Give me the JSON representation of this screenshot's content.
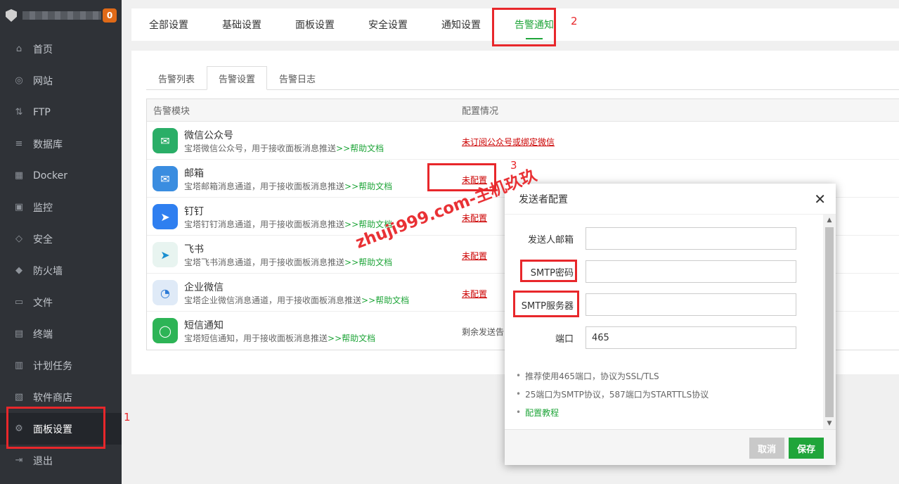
{
  "sidebar": {
    "badge": "0",
    "items": [
      {
        "label": "首页",
        "icon": "home-icon",
        "glyph": "⌂"
      },
      {
        "label": "网站",
        "icon": "globe-icon",
        "glyph": "◎"
      },
      {
        "label": "FTP",
        "icon": "ftp-icon",
        "glyph": "⇅"
      },
      {
        "label": "数据库",
        "icon": "database-icon",
        "glyph": "≡"
      },
      {
        "label": "Docker",
        "icon": "docker-icon",
        "glyph": "▦"
      },
      {
        "label": "监控",
        "icon": "monitor-icon",
        "glyph": "▣"
      },
      {
        "label": "安全",
        "icon": "shield-icon",
        "glyph": "◇"
      },
      {
        "label": "防火墙",
        "icon": "firewall-icon",
        "glyph": "◆"
      },
      {
        "label": "文件",
        "icon": "folder-icon",
        "glyph": "▭"
      },
      {
        "label": "终端",
        "icon": "terminal-icon",
        "glyph": "▤"
      },
      {
        "label": "计划任务",
        "icon": "calendar-icon",
        "glyph": "▥"
      },
      {
        "label": "软件商店",
        "icon": "store-icon",
        "glyph": "▧"
      },
      {
        "label": "面板设置",
        "icon": "gear-icon",
        "glyph": "⚙"
      },
      {
        "label": "退出",
        "icon": "logout-icon",
        "glyph": "⇥"
      }
    ]
  },
  "annotations": {
    "one": "1",
    "two": "2",
    "three": "3"
  },
  "top_tabs": [
    "全部设置",
    "基础设置",
    "面板设置",
    "安全设置",
    "通知设置",
    "告警通知"
  ],
  "sub_tabs": [
    "告警列表",
    "告警设置",
    "告警日志"
  ],
  "table": {
    "headers": [
      "告警模块",
      "配置情况"
    ],
    "rows": [
      {
        "title": "微信公众号",
        "desc": "宝塔微信公众号，用于接收面板消息推送",
        "link": ">>帮助文档",
        "status": "未订阅公众号或绑定微信",
        "color": "#2aae67",
        "glyph": "✉"
      },
      {
        "title": "邮箱",
        "desc": "宝塔邮箱消息通道，用于接收面板消息推送",
        "link": ">>帮助文档",
        "status": "未配置",
        "color": "#3a8de0",
        "glyph": "✉"
      },
      {
        "title": "钉钉",
        "desc": "宝塔钉钉消息通道，用于接收面板消息推送",
        "link": ">>帮助文档",
        "status": "未配置",
        "color": "#2f7ff0",
        "glyph": "➤"
      },
      {
        "title": "飞书",
        "desc": "宝塔飞书消息通道，用于接收面板消息推送",
        "link": ">>帮助文档",
        "status": "未配置",
        "color": "#e8f4f0",
        "glyph": "➤"
      },
      {
        "title": "企业微信",
        "desc": "宝塔企业微信消息通道，用于接收面板消息推送",
        "link": ">>帮助文档",
        "status": "未配置",
        "color": "#dfeaf7",
        "glyph": "◔"
      },
      {
        "title": "短信通知",
        "desc": "宝塔短信通知，用于接收面板消息推送",
        "link": ">>帮助文档",
        "status": "剩余发送告",
        "color": "#2db456",
        "glyph": "◯"
      }
    ]
  },
  "watermark": "zhuji999.com-主机玖玖",
  "modal": {
    "title": "发送者配置",
    "close": "✕",
    "fields": [
      {
        "label": "发送人邮箱",
        "value": ""
      },
      {
        "label": "SMTP密码",
        "value": ""
      },
      {
        "label": "SMTP服务器",
        "value": ""
      },
      {
        "label": "端口",
        "value": "465"
      }
    ],
    "tips": [
      "推荐使用465端口，协议为SSL/TLS",
      "25端口为SMTP协议，587端口为STARTTLS协议",
      "配置教程"
    ],
    "cancel": "取消",
    "save": "保存"
  }
}
